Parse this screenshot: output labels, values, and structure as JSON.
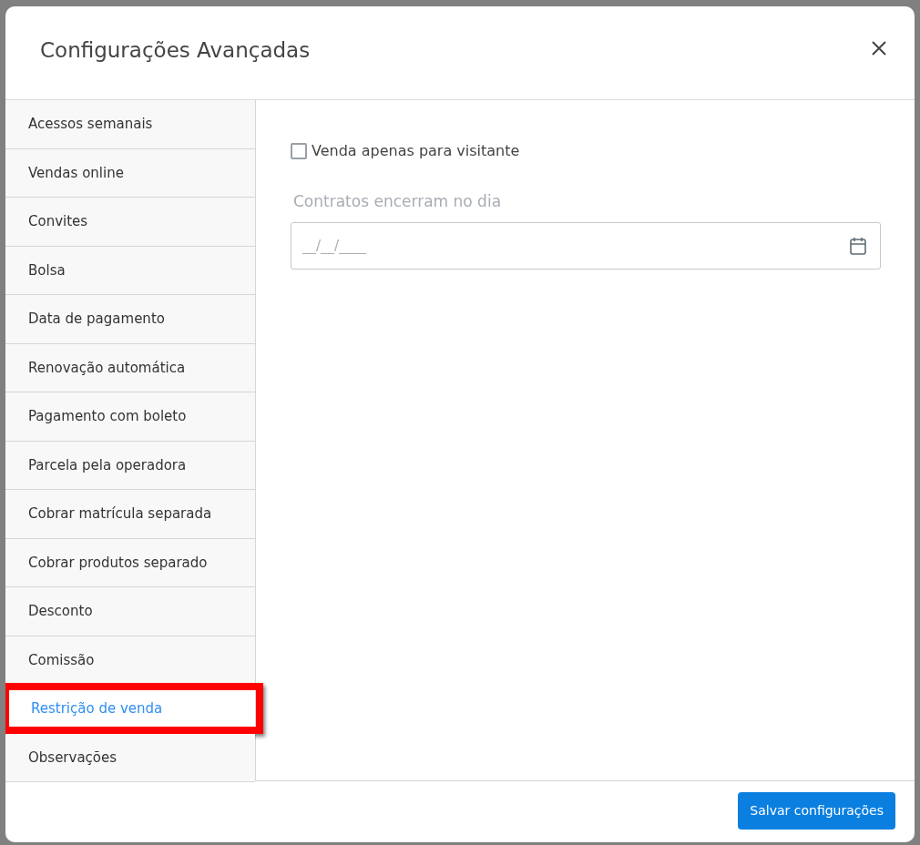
{
  "dialog": {
    "title": "Configurações Avançadas"
  },
  "sidebar": {
    "items": [
      {
        "label": "Acessos semanais",
        "selected": false,
        "highlighted": false
      },
      {
        "label": "Vendas online",
        "selected": false,
        "highlighted": false
      },
      {
        "label": "Convites",
        "selected": false,
        "highlighted": false
      },
      {
        "label": "Bolsa",
        "selected": false,
        "highlighted": false
      },
      {
        "label": "Data de pagamento",
        "selected": false,
        "highlighted": false
      },
      {
        "label": "Renovação automática",
        "selected": false,
        "highlighted": false
      },
      {
        "label": "Pagamento com boleto",
        "selected": false,
        "highlighted": false
      },
      {
        "label": "Parcela pela operadora",
        "selected": false,
        "highlighted": false
      },
      {
        "label": "Cobrar matrícula separada",
        "selected": false,
        "highlighted": false
      },
      {
        "label": "Cobrar produtos separado",
        "selected": false,
        "highlighted": false
      },
      {
        "label": "Desconto",
        "selected": false,
        "highlighted": false
      },
      {
        "label": "Comissão",
        "selected": false,
        "highlighted": false
      },
      {
        "label": "Restrição de venda",
        "selected": true,
        "highlighted": true
      },
      {
        "label": "Observações",
        "selected": false,
        "highlighted": false
      }
    ]
  },
  "content": {
    "checkbox": {
      "label": "Venda apenas para visitante",
      "checked": false
    },
    "date_field": {
      "label": "Contratos encerram no dia",
      "placeholder": "__/__/____"
    }
  },
  "footer": {
    "save_button": "Salvar configurações"
  }
}
